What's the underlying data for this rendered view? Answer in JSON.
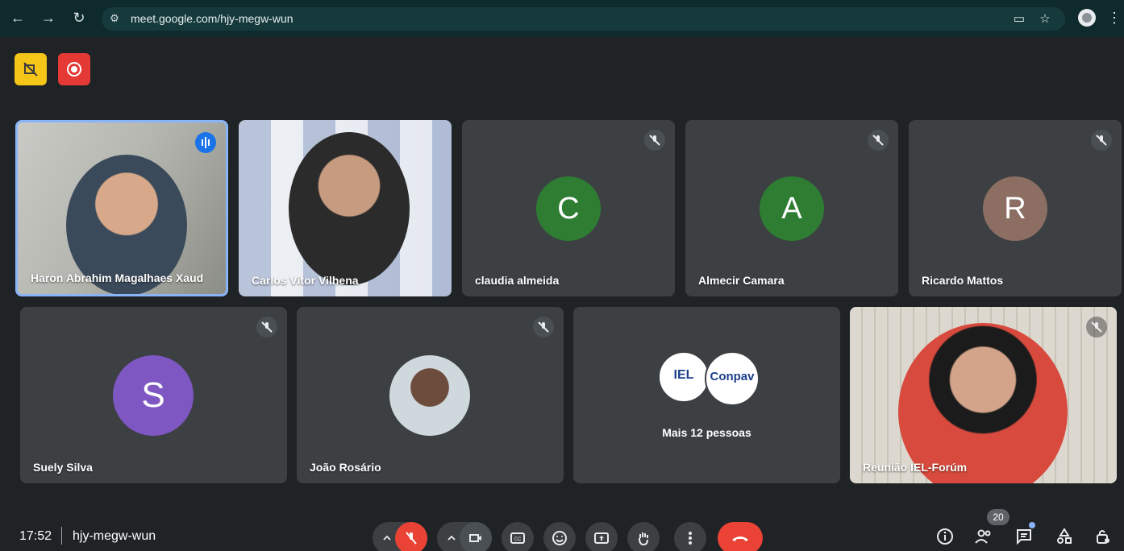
{
  "browser": {
    "url": "meet.google.com/hjy-megw-wun",
    "icons": [
      "back-icon",
      "forward-icon",
      "reload-icon",
      "site-settings-icon",
      "cast-icon",
      "star-icon",
      "profile-icon",
      "menu-icon"
    ]
  },
  "top_badges": [
    {
      "name": "captions-off-badge",
      "color": "#f5c518"
    },
    {
      "name": "recording-badge",
      "color": "#e53935"
    }
  ],
  "participants": [
    {
      "name": "Haron Abrahim Magalhaes Xaud",
      "type": "video",
      "speaking": true
    },
    {
      "name": "Carlos Vitor Vilhena",
      "type": "video"
    },
    {
      "name": "claudia almeida",
      "initial": "C",
      "avatar_color": "#2e7d32",
      "muted": true
    },
    {
      "name": "Almecir Camara",
      "initial": "A",
      "avatar_color": "#2e7d32",
      "muted": true
    },
    {
      "name": "Ricardo Mattos",
      "initial": "R",
      "avatar_color": "#8d6e63",
      "muted": true
    },
    {
      "name": "Suely Silva",
      "initial": "S",
      "avatar_color": "#7e57c2",
      "muted": true
    },
    {
      "name": "João Rosário",
      "type": "photo",
      "muted": true
    },
    {
      "name": "Mais 12 pessoas",
      "type": "group",
      "logos": [
        "IEL",
        "Conpav"
      ]
    },
    {
      "name": "Reunião IEL-Forúm",
      "type": "video",
      "muted": true
    }
  ],
  "bottom": {
    "time": "17:52",
    "meeting_code": "hjy-megw-wun",
    "participant_count": "20",
    "controls": [
      "mic-options",
      "mic-off",
      "camera-options",
      "camera",
      "captions",
      "emoji",
      "present",
      "raise-hand",
      "more-options",
      "leave-call"
    ],
    "right": [
      "info",
      "people",
      "chat",
      "activities",
      "host-controls"
    ]
  }
}
